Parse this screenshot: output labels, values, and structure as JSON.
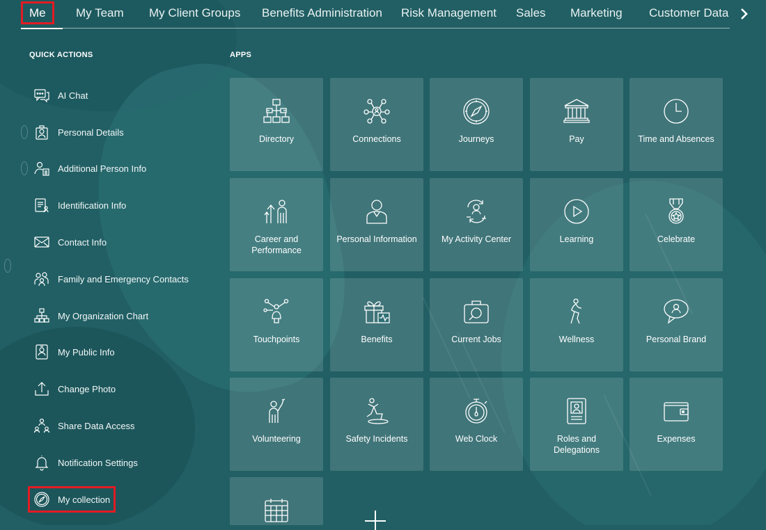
{
  "nav": {
    "items": [
      {
        "label": "Me",
        "active": true
      },
      {
        "label": "My Team"
      },
      {
        "label": "My Client Groups"
      },
      {
        "label": "Benefits Administration"
      },
      {
        "label": "Risk Management"
      },
      {
        "label": "Sales"
      },
      {
        "label": "Marketing"
      },
      {
        "label": "Customer Data P"
      }
    ],
    "next_icon": "chevron-right-icon"
  },
  "quick_actions": {
    "title": "QUICK ACTIONS",
    "items": [
      {
        "label": "AI Chat",
        "icon": "chat-icon"
      },
      {
        "label": "Personal Details",
        "icon": "person-card-icon"
      },
      {
        "label": "Additional Person Info",
        "icon": "person-info-icon"
      },
      {
        "label": "Identification Info",
        "icon": "id-document-icon"
      },
      {
        "label": "Contact Info",
        "icon": "envelope-icon"
      },
      {
        "label": "Family and Emergency Contacts",
        "icon": "family-icon"
      },
      {
        "label": "My Organization Chart",
        "icon": "org-chart-icon"
      },
      {
        "label": "My Public Info",
        "icon": "badge-icon"
      },
      {
        "label": "Change Photo",
        "icon": "upload-tray-icon"
      },
      {
        "label": "Share Data Access",
        "icon": "share-people-icon"
      },
      {
        "label": "Notification Settings",
        "icon": "bell-icon"
      },
      {
        "label": "My collection",
        "icon": "compass-icon"
      }
    ]
  },
  "apps": {
    "title": "APPS",
    "tiles": [
      {
        "label": "Directory",
        "icon": "directory-icon"
      },
      {
        "label": "Connections",
        "icon": "connections-icon"
      },
      {
        "label": "Journeys",
        "icon": "compass-icon"
      },
      {
        "label": "Pay",
        "icon": "bank-icon"
      },
      {
        "label": "Time and Absences",
        "icon": "clock-icon"
      },
      {
        "label": "Career and Performance",
        "icon": "career-icon"
      },
      {
        "label": "Personal Information",
        "icon": "person-icon"
      },
      {
        "label": "My Activity Center",
        "icon": "activity-icon"
      },
      {
        "label": "Learning",
        "icon": "play-icon"
      },
      {
        "label": "Celebrate",
        "icon": "medal-icon"
      },
      {
        "label": "Touchpoints",
        "icon": "touchpoints-icon"
      },
      {
        "label": "Benefits",
        "icon": "gift-icon"
      },
      {
        "label": "Current Jobs",
        "icon": "briefcase-icon"
      },
      {
        "label": "Wellness",
        "icon": "wellness-icon"
      },
      {
        "label": "Personal Brand",
        "icon": "brand-chat-icon"
      },
      {
        "label": "Volunteering",
        "icon": "volunteer-icon"
      },
      {
        "label": "Safety Incidents",
        "icon": "safety-icon"
      },
      {
        "label": "Web Clock",
        "icon": "stopwatch-icon"
      },
      {
        "label": "Roles and Delegations",
        "icon": "roles-icon"
      },
      {
        "label": "Expenses",
        "icon": "wallet-icon"
      },
      {
        "label": "",
        "icon": "calendar-icon"
      }
    ],
    "add_icon": "plus-icon"
  },
  "colors": {
    "background": "#215f64",
    "highlight": "#e31b23",
    "tile": "rgba(255,255,255,0.14)"
  }
}
